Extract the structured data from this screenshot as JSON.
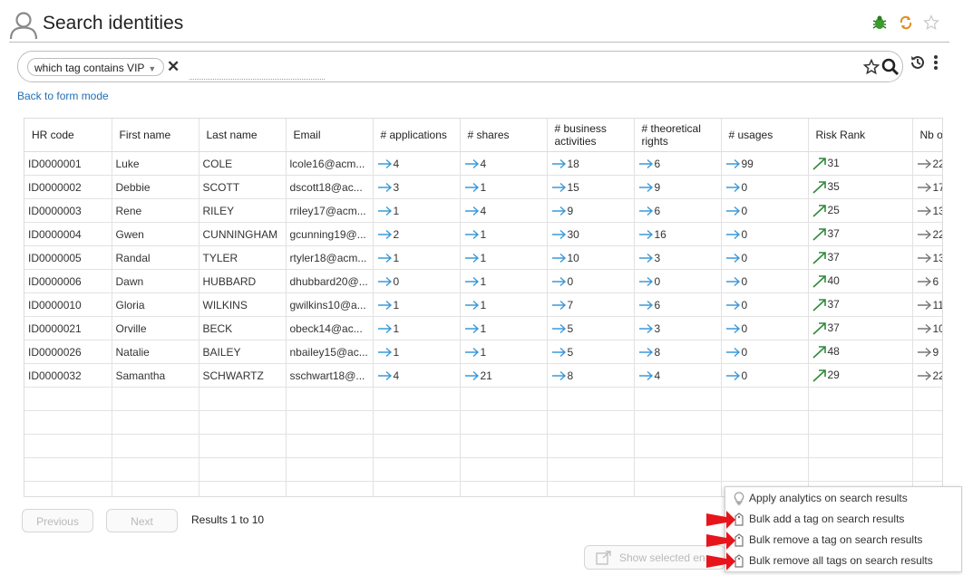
{
  "header": {
    "title": "Search identities"
  },
  "search": {
    "chip_label": "which tag contains VIP",
    "input_value": "",
    "input_placeholder": ""
  },
  "back_link": "Back to form mode",
  "table": {
    "columns": [
      "HR code",
      "First name",
      "Last name",
      "Email",
      "# applications",
      "# shares",
      "# business activities",
      "# theoretical rights",
      "# usages",
      "Risk Rank",
      "Nb o"
    ],
    "rows": [
      {
        "hr": "ID0000001",
        "first": "Luke",
        "last": "COLE",
        "email": "lcole16@acm...",
        "apps": "4",
        "shares": "4",
        "biz": "18",
        "rights": "6",
        "usages": "99",
        "risk": "31",
        "nb": "22"
      },
      {
        "hr": "ID0000002",
        "first": "Debbie",
        "last": "SCOTT",
        "email": "dscott18@ac...",
        "apps": "3",
        "shares": "1",
        "biz": "15",
        "rights": "9",
        "usages": "0",
        "risk": "35",
        "nb": "17"
      },
      {
        "hr": "ID0000003",
        "first": "Rene",
        "last": "RILEY",
        "email": "rriley17@acm...",
        "apps": "1",
        "shares": "4",
        "biz": "9",
        "rights": "6",
        "usages": "0",
        "risk": "25",
        "nb": "13"
      },
      {
        "hr": "ID0000004",
        "first": "Gwen",
        "last": "CUNNINGHAM",
        "email": "gcunning19@...",
        "apps": "2",
        "shares": "1",
        "biz": "30",
        "rights": "16",
        "usages": "0",
        "risk": "37",
        "nb": "22"
      },
      {
        "hr": "ID0000005",
        "first": "Randal",
        "last": "TYLER",
        "email": "rtyler18@acm...",
        "apps": "1",
        "shares": "1",
        "biz": "10",
        "rights": "3",
        "usages": "0",
        "risk": "37",
        "nb": "13"
      },
      {
        "hr": "ID0000006",
        "first": "Dawn",
        "last": "HUBBARD",
        "email": "dhubbard20@...",
        "apps": "0",
        "shares": "1",
        "biz": "0",
        "rights": "0",
        "usages": "0",
        "risk": "40",
        "nb": "6"
      },
      {
        "hr": "ID0000010",
        "first": "Gloria",
        "last": "WILKINS",
        "email": "gwilkins10@a...",
        "apps": "1",
        "shares": "1",
        "biz": "7",
        "rights": "6",
        "usages": "0",
        "risk": "37",
        "nb": "11"
      },
      {
        "hr": "ID0000021",
        "first": "Orville",
        "last": "BECK",
        "email": "obeck14@ac...",
        "apps": "1",
        "shares": "1",
        "biz": "5",
        "rights": "3",
        "usages": "0",
        "risk": "37",
        "nb": "10"
      },
      {
        "hr": "ID0000026",
        "first": "Natalie",
        "last": "BAILEY",
        "email": "nbailey15@ac...",
        "apps": "1",
        "shares": "1",
        "biz": "5",
        "rights": "8",
        "usages": "0",
        "risk": "48",
        "nb": "9"
      },
      {
        "hr": "ID0000032",
        "first": "Samantha",
        "last": "SCHWARTZ",
        "email": "sschwart18@...",
        "apps": "4",
        "shares": "21",
        "biz": "8",
        "rights": "4",
        "usages": "0",
        "risk": "29",
        "nb": "22"
      }
    ]
  },
  "pagination": {
    "previous_label": "Previous",
    "next_label": "Next",
    "results_text": "Results 1 to 10"
  },
  "show_selected_label": "Show selected en",
  "context_menu": {
    "items": [
      {
        "label": "Apply analytics on search results",
        "icon": "lightbulb-icon"
      },
      {
        "label": "Bulk add a tag on search results",
        "icon": "tag-icon"
      },
      {
        "label": "Bulk remove a tag on search results",
        "icon": "tag-icon"
      },
      {
        "label": "Bulk remove all tags on search results",
        "icon": "tag-icon"
      }
    ]
  },
  "colors": {
    "link": "#1f6fb4",
    "count_arrow": "#3a9ad9",
    "risk_arrow": "#2e8b3a",
    "nb_arrow": "#777777",
    "annotation_arrow": "#e8141b"
  }
}
